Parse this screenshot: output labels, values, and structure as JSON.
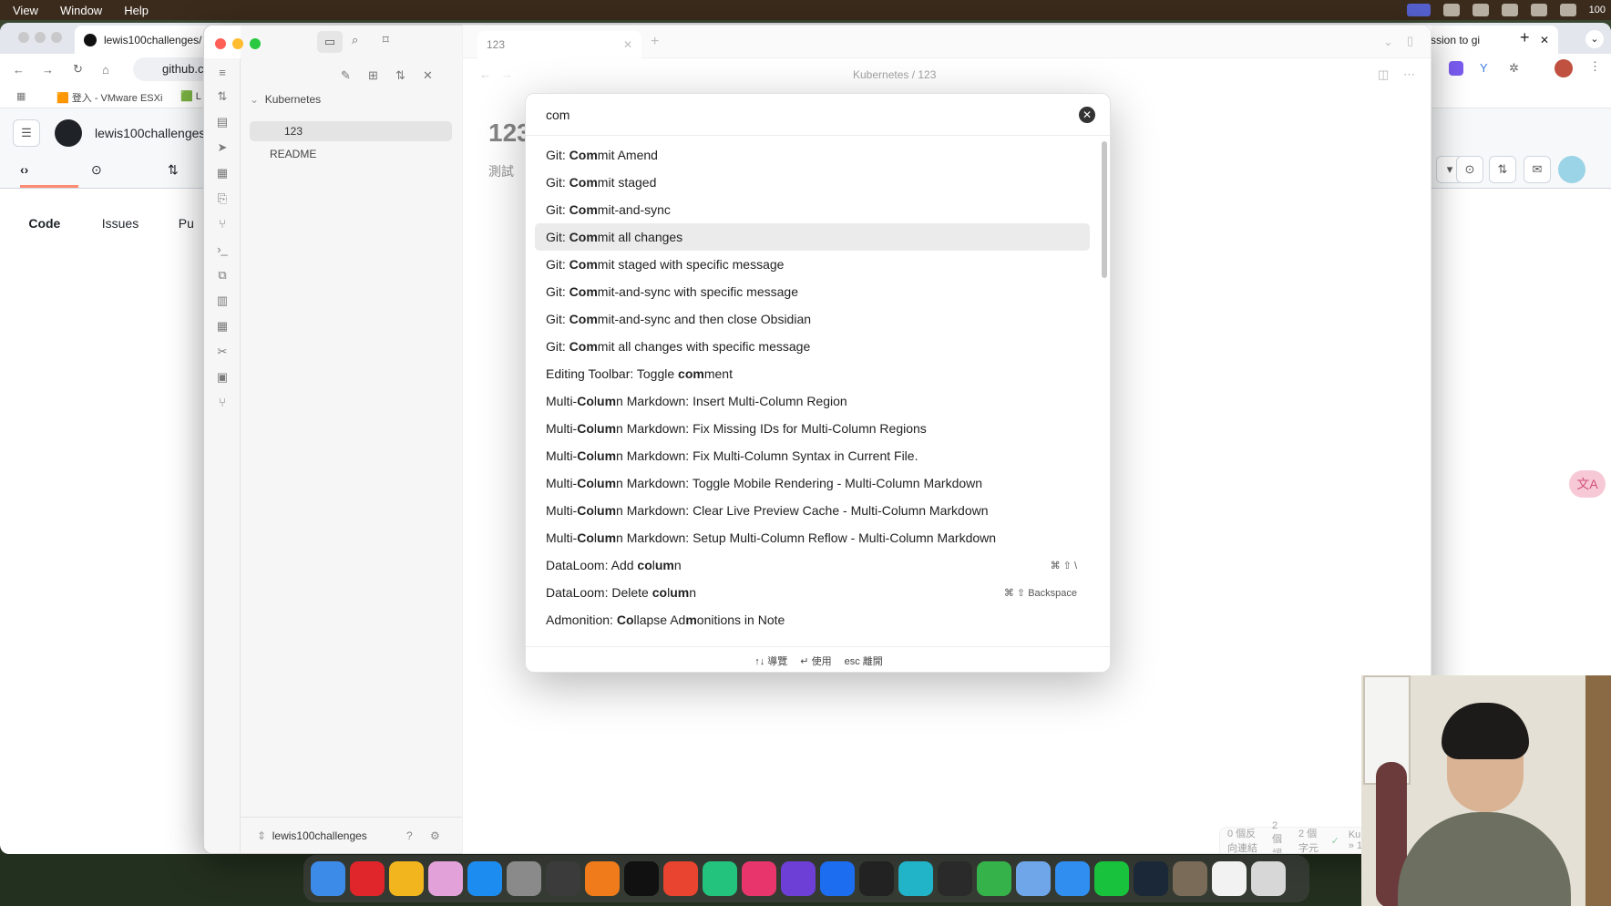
{
  "menubar": {
    "items": [
      "View",
      "Window",
      "Help"
    ],
    "status_text": "100"
  },
  "chrome": {
    "active_tab": "lewis100challenges/",
    "right_tab": "ssion to gi",
    "address": "github.c",
    "bookmark_vmware": "登入 - VMware ESXi",
    "bookmark_l": "L",
    "github_user": "lewis100challenges",
    "gh_tabs": {
      "code": "Code",
      "issues": "Issues",
      "pulls": "Pu"
    }
  },
  "obsidian": {
    "vault_folder": "Kubernetes",
    "file_123": "123",
    "file_readme": "README",
    "vault_name": "lewis100challenges",
    "tab_title": "123",
    "breadcrumb": "Kubernetes / 123",
    "doc_title": "123",
    "doc_body": "測試",
    "status": {
      "backlinks": "0 個反向連結",
      "words": "2 個詞",
      "chars": "2 個字元",
      "path": "Kubernetes » 123.md"
    }
  },
  "palette": {
    "query": "com",
    "items": [
      {
        "parts": [
          [
            "Git: ",
            false
          ],
          [
            "Com",
            true
          ],
          [
            "mit Amend",
            false
          ]
        ],
        "hotkey": ""
      },
      {
        "parts": [
          [
            "Git: ",
            false
          ],
          [
            "Com",
            true
          ],
          [
            "mit staged",
            false
          ]
        ],
        "hotkey": ""
      },
      {
        "parts": [
          [
            "Git: ",
            false
          ],
          [
            "Com",
            true
          ],
          [
            "mit-and-sync",
            false
          ]
        ],
        "hotkey": ""
      },
      {
        "parts": [
          [
            "Git: ",
            false
          ],
          [
            "Com",
            true
          ],
          [
            "mit all changes",
            false
          ]
        ],
        "hotkey": ""
      },
      {
        "parts": [
          [
            "Git: ",
            false
          ],
          [
            "Com",
            true
          ],
          [
            "mit staged with specific message",
            false
          ]
        ],
        "hotkey": ""
      },
      {
        "parts": [
          [
            "Git: ",
            false
          ],
          [
            "Com",
            true
          ],
          [
            "mit-and-sync with specific message",
            false
          ]
        ],
        "hotkey": ""
      },
      {
        "parts": [
          [
            "Git: ",
            false
          ],
          [
            "Com",
            true
          ],
          [
            "mit-and-sync and then close Obsidian",
            false
          ]
        ],
        "hotkey": ""
      },
      {
        "parts": [
          [
            "Git: ",
            false
          ],
          [
            "Com",
            true
          ],
          [
            "mit all changes with specific message",
            false
          ]
        ],
        "hotkey": ""
      },
      {
        "parts": [
          [
            "Editing Toolbar: Toggle ",
            false
          ],
          [
            "com",
            true
          ],
          [
            "ment",
            false
          ]
        ],
        "hotkey": ""
      },
      {
        "parts": [
          [
            "Multi-",
            false
          ],
          [
            "Co",
            true
          ],
          [
            "l",
            false
          ],
          [
            "um",
            true
          ],
          [
            "n Markdown: Insert Multi-Column Region",
            false
          ]
        ],
        "hotkey": ""
      },
      {
        "parts": [
          [
            "Multi-",
            false
          ],
          [
            "Co",
            true
          ],
          [
            "l",
            false
          ],
          [
            "um",
            true
          ],
          [
            "n Markdown: Fix Missing IDs for Multi-Column Regions",
            false
          ]
        ],
        "hotkey": ""
      },
      {
        "parts": [
          [
            "Multi-",
            false
          ],
          [
            "Co",
            true
          ],
          [
            "l",
            false
          ],
          [
            "um",
            true
          ],
          [
            "n Markdown: Fix Multi-Column Syntax in Current File.",
            false
          ]
        ],
        "hotkey": ""
      },
      {
        "parts": [
          [
            "Multi-",
            false
          ],
          [
            "Co",
            true
          ],
          [
            "l",
            false
          ],
          [
            "um",
            true
          ],
          [
            "n Markdown: Toggle Mobile Rendering - Multi-Column Markdown",
            false
          ]
        ],
        "hotkey": ""
      },
      {
        "parts": [
          [
            "Multi-",
            false
          ],
          [
            "Co",
            true
          ],
          [
            "l",
            false
          ],
          [
            "um",
            true
          ],
          [
            "n Markdown: Clear Live Preview Cache - Multi-Column Markdown",
            false
          ]
        ],
        "hotkey": ""
      },
      {
        "parts": [
          [
            "Multi-",
            false
          ],
          [
            "Co",
            true
          ],
          [
            "l",
            false
          ],
          [
            "um",
            true
          ],
          [
            "n Markdown: Setup Multi-Column Reflow - Multi-Column Markdown",
            false
          ]
        ],
        "hotkey": ""
      },
      {
        "parts": [
          [
            "DataLoom: Add ",
            false
          ],
          [
            "co",
            true
          ],
          [
            "l",
            false
          ],
          [
            "um",
            true
          ],
          [
            "n",
            false
          ]
        ],
        "hotkey": "⌘ ⇧ \\"
      },
      {
        "parts": [
          [
            "DataLoom: Delete ",
            false
          ],
          [
            "co",
            true
          ],
          [
            "l",
            false
          ],
          [
            "um",
            true
          ],
          [
            "n",
            false
          ]
        ],
        "hotkey": "⌘ ⇧ Backspace"
      },
      {
        "parts": [
          [
            "Admonition: ",
            false
          ],
          [
            "Co",
            true
          ],
          [
            "llapse Ad",
            false
          ],
          [
            "m",
            true
          ],
          [
            "onitions in Note",
            false
          ]
        ],
        "hotkey": ""
      }
    ],
    "selected_index": 3,
    "footer": {
      "navigate": "↑↓ 導覽",
      "use": "↵ 使用",
      "dismiss": "esc 離開"
    }
  },
  "dock_apps": [
    "finder",
    "youtube-music",
    "chrome",
    "photos",
    "app-store",
    "settings",
    "obs",
    "sublime",
    "terminal",
    "anydesk",
    "pycharm",
    "intellij",
    "obsidian",
    "zoom",
    "capcut",
    "canva",
    "chatgpt",
    "numbers",
    "voice",
    "messenger",
    "line",
    "steam",
    "gimp",
    "textedit",
    "trash"
  ]
}
